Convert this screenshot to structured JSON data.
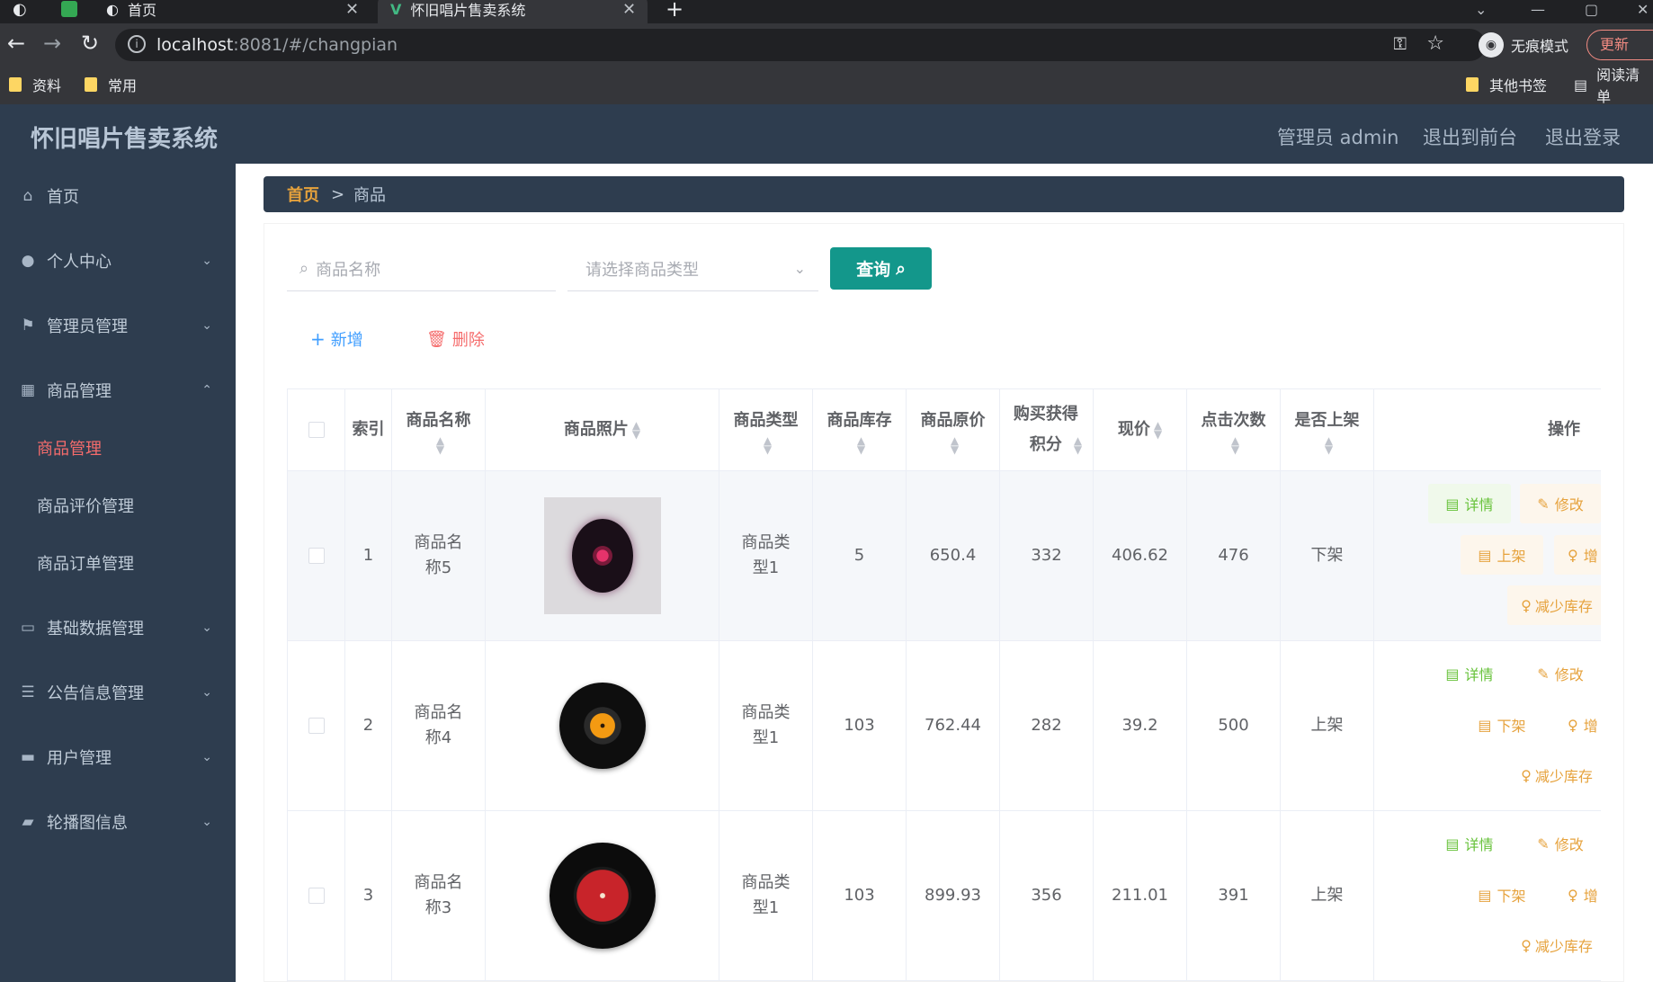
{
  "browser": {
    "tabs": [
      {
        "title": "首页"
      },
      {
        "title": "怀旧唱片售卖系统"
      }
    ],
    "new_tab": "+",
    "url_host": "localhost",
    "url_rest": ":8081/#/changpian",
    "incognito_label": "无痕模式",
    "update_label": "更新",
    "bookmarks": [
      "资料",
      "常用"
    ],
    "bookmarks_right": [
      "其他书签",
      "阅读清单"
    ]
  },
  "header": {
    "title": "怀旧唱片售卖系统",
    "admin": "管理员 admin",
    "to_front": "退出到前台",
    "logout": "退出登录"
  },
  "sidebar": {
    "items": [
      {
        "label": "首页",
        "icon": "home-icon"
      },
      {
        "label": "个人中心",
        "icon": "user-icon"
      },
      {
        "label": "管理员管理",
        "icon": "flag-icon"
      },
      {
        "label": "商品管理",
        "icon": "grid-icon"
      },
      {
        "label": "基础数据管理",
        "icon": "chat-icon"
      },
      {
        "label": "公告信息管理",
        "icon": "list-icon"
      },
      {
        "label": "用户管理",
        "icon": "monitor-icon"
      },
      {
        "label": "轮播图信息",
        "icon": "ticket-icon"
      }
    ],
    "sub_items": [
      "商品管理",
      "商品评价管理",
      "商品订单管理"
    ]
  },
  "breadcrumb": {
    "home": "首页",
    "sep": ">",
    "current": "商品"
  },
  "search": {
    "name_placeholder": "商品名称",
    "type_placeholder": "请选择商品类型",
    "query_label": "查询"
  },
  "toolbar": {
    "add_label": "新增",
    "delete_label": "删除"
  },
  "table": {
    "headers": {
      "index": "索引",
      "name": "商品名称",
      "photo": "商品照片",
      "type": "商品类型",
      "stock": "商品库存",
      "orig_price": "商品原价",
      "points": "购买获得积分",
      "price": "现价",
      "clicks": "点击次数",
      "on_sale": "是否上架",
      "ops": "操作"
    },
    "rows": [
      {
        "index": "1",
        "name": "商品名称5",
        "type": "商品类型1",
        "stock": "5",
        "orig_price": "650.4",
        "points": "332",
        "price": "406.62",
        "clicks": "476",
        "on_sale": "下架",
        "toggle": "上架"
      },
      {
        "index": "2",
        "name": "商品名称4",
        "type": "商品类型1",
        "stock": "103",
        "orig_price": "762.44",
        "points": "282",
        "price": "39.2",
        "clicks": "500",
        "on_sale": "上架",
        "toggle": "下架"
      },
      {
        "index": "3",
        "name": "商品名称3",
        "type": "商品类型1",
        "stock": "103",
        "orig_price": "899.93",
        "points": "356",
        "price": "211.01",
        "clicks": "391",
        "on_sale": "上架",
        "toggle": "下架"
      }
    ],
    "ops": {
      "detail": "详情",
      "edit": "修改",
      "add_stock": "增",
      "reduce_stock": "减少库存"
    }
  },
  "colors": {
    "accent": "#13978b",
    "danger": "#f56c6c",
    "sidebar": "#2e3d4f"
  }
}
